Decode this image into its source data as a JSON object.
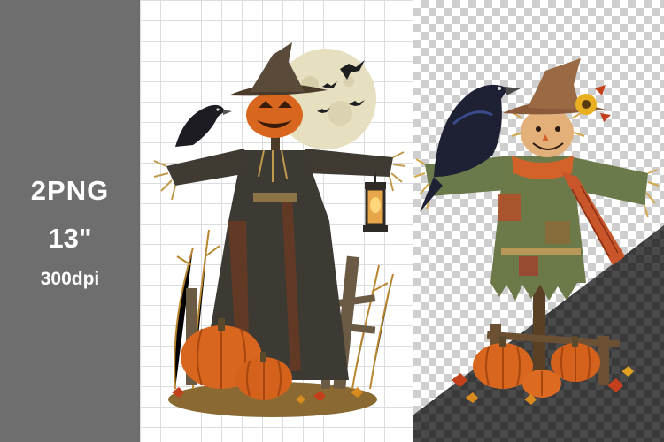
{
  "badge": {
    "format": "2PNG",
    "size": "13\"",
    "resolution": "300dpi"
  },
  "colors": {
    "side_panel": "#6e6e6e",
    "grid_line": "#dcdde0",
    "checker_light": "#cfcfcf",
    "checker_dark": "#3a3a3a",
    "pumpkin": "#d8661e",
    "moon": "#e9e2c4"
  },
  "images": [
    {
      "name": "scarecrow-jack-o-lantern-illustration"
    },
    {
      "name": "scarecrow-smiling-with-crow-illustration"
    }
  ]
}
